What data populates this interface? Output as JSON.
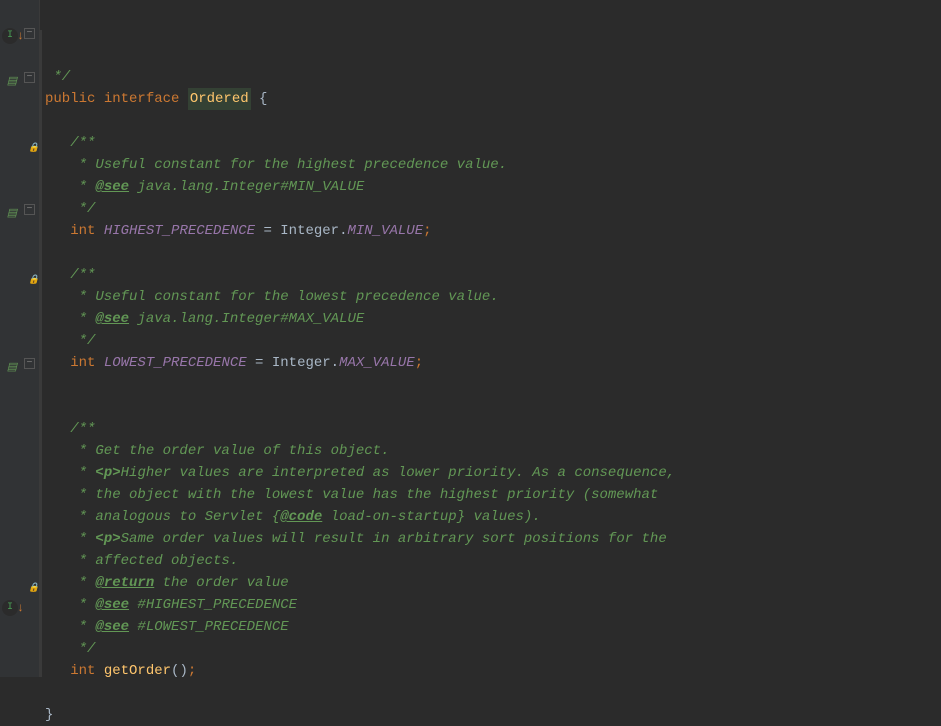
{
  "lines": [
    {
      "gutter": [],
      "tokens": [
        {
          "t": " */",
          "c": "doc"
        }
      ]
    },
    {
      "gutter": [
        "impl",
        "fold"
      ],
      "tokens": [
        {
          "t": "public ",
          "c": "kw"
        },
        {
          "t": "interface ",
          "c": "interface-kw"
        },
        {
          "t": "Ordered",
          "c": "class-name"
        },
        {
          "t": " {",
          "c": "brace"
        }
      ]
    },
    {
      "gutter": [],
      "tokens": []
    },
    {
      "gutter": [
        "block",
        "fold"
      ],
      "tokens": [
        {
          "t": "   /**",
          "c": "doc"
        }
      ]
    },
    {
      "gutter": [],
      "tokens": [
        {
          "t": "    * Useful constant for the highest precedence value.",
          "c": "doc"
        }
      ]
    },
    {
      "gutter": [],
      "tokens": [
        {
          "t": "    * ",
          "c": "doc"
        },
        {
          "t": "@see",
          "c": "doc-tag"
        },
        {
          "t": " java.lang.Integer",
          "c": "doc"
        },
        {
          "t": "#MIN_VALUE",
          "c": "doc"
        }
      ]
    },
    {
      "gutter": [
        "lock"
      ],
      "tokens": [
        {
          "t": "    */",
          "c": "doc"
        }
      ]
    },
    {
      "gutter": [],
      "tokens": [
        {
          "t": "   ",
          "c": "normal"
        },
        {
          "t": "int ",
          "c": "kw"
        },
        {
          "t": "HIGHEST_PRECEDENCE",
          "c": "static-field"
        },
        {
          "t": " = Integer.",
          "c": "normal"
        },
        {
          "t": "MIN_VALUE",
          "c": "static-field"
        },
        {
          "t": ";",
          "c": "semi"
        }
      ]
    },
    {
      "gutter": [],
      "tokens": []
    },
    {
      "gutter": [
        "block",
        "fold"
      ],
      "tokens": [
        {
          "t": "   /**",
          "c": "doc"
        }
      ]
    },
    {
      "gutter": [],
      "tokens": [
        {
          "t": "    * Useful constant for the lowest precedence value.",
          "c": "doc"
        }
      ]
    },
    {
      "gutter": [],
      "tokens": [
        {
          "t": "    * ",
          "c": "doc"
        },
        {
          "t": "@see",
          "c": "doc-tag"
        },
        {
          "t": " java.lang.Integer",
          "c": "doc"
        },
        {
          "t": "#MAX_VALUE",
          "c": "doc"
        }
      ]
    },
    {
      "gutter": [
        "lock"
      ],
      "tokens": [
        {
          "t": "    */",
          "c": "doc"
        }
      ]
    },
    {
      "gutter": [],
      "tokens": [
        {
          "t": "   ",
          "c": "normal"
        },
        {
          "t": "int ",
          "c": "kw"
        },
        {
          "t": "LOWEST_PRECEDENCE",
          "c": "static-field"
        },
        {
          "t": " = Integer.",
          "c": "normal"
        },
        {
          "t": "MAX_VALUE",
          "c": "static-field"
        },
        {
          "t": ";",
          "c": "semi"
        }
      ]
    },
    {
      "gutter": [],
      "tokens": []
    },
    {
      "gutter": [],
      "tokens": []
    },
    {
      "gutter": [
        "block",
        "fold"
      ],
      "tokens": [
        {
          "t": "   /**",
          "c": "doc"
        }
      ]
    },
    {
      "gutter": [],
      "tokens": [
        {
          "t": "    * Get the order value of this object.",
          "c": "doc"
        }
      ]
    },
    {
      "gutter": [],
      "tokens": [
        {
          "t": "    * ",
          "c": "doc"
        },
        {
          "t": "<p>",
          "c": "doc-tag-nolink"
        },
        {
          "t": "Higher values are interpreted as lower priority. As a consequence,",
          "c": "doc"
        }
      ]
    },
    {
      "gutter": [],
      "tokens": [
        {
          "t": "    * the object with the lowest value has the highest priority (somewhat",
          "c": "doc"
        }
      ]
    },
    {
      "gutter": [],
      "tokens": [
        {
          "t": "    * analogous to Servlet {",
          "c": "doc"
        },
        {
          "t": "@code",
          "c": "doc-tag"
        },
        {
          "t": " load-on-startup} values).",
          "c": "doc"
        }
      ]
    },
    {
      "gutter": [],
      "tokens": [
        {
          "t": "    * ",
          "c": "doc"
        },
        {
          "t": "<p>",
          "c": "doc-tag-nolink"
        },
        {
          "t": "Same order values will result in arbitrary sort positions for the",
          "c": "doc"
        }
      ]
    },
    {
      "gutter": [],
      "tokens": [
        {
          "t": "    * affected objects.",
          "c": "doc"
        }
      ]
    },
    {
      "gutter": [],
      "tokens": [
        {
          "t": "    * ",
          "c": "doc"
        },
        {
          "t": "@return",
          "c": "doc-tag"
        },
        {
          "t": " the order value",
          "c": "doc"
        }
      ]
    },
    {
      "gutter": [],
      "tokens": [
        {
          "t": "    * ",
          "c": "doc"
        },
        {
          "t": "@see",
          "c": "doc-tag"
        },
        {
          "t": " #HIGHEST_PRECEDENCE",
          "c": "doc"
        }
      ]
    },
    {
      "gutter": [],
      "tokens": [
        {
          "t": "    * ",
          "c": "doc"
        },
        {
          "t": "@see",
          "c": "doc-tag"
        },
        {
          "t": " #LOWEST_PRECEDENCE",
          "c": "doc"
        }
      ]
    },
    {
      "gutter": [
        "lock"
      ],
      "tokens": [
        {
          "t": "    */",
          "c": "doc"
        }
      ]
    },
    {
      "gutter": [
        "impl"
      ],
      "tokens": [
        {
          "t": "   ",
          "c": "normal"
        },
        {
          "t": "int ",
          "c": "kw"
        },
        {
          "t": "getOrder",
          "c": "method"
        },
        {
          "t": "()",
          "c": "paren"
        },
        {
          "t": ";",
          "c": "semi"
        }
      ]
    },
    {
      "gutter": [],
      "tokens": []
    },
    {
      "gutter": [],
      "tokens": [
        {
          "t": "}",
          "c": "brace"
        }
      ]
    }
  ]
}
